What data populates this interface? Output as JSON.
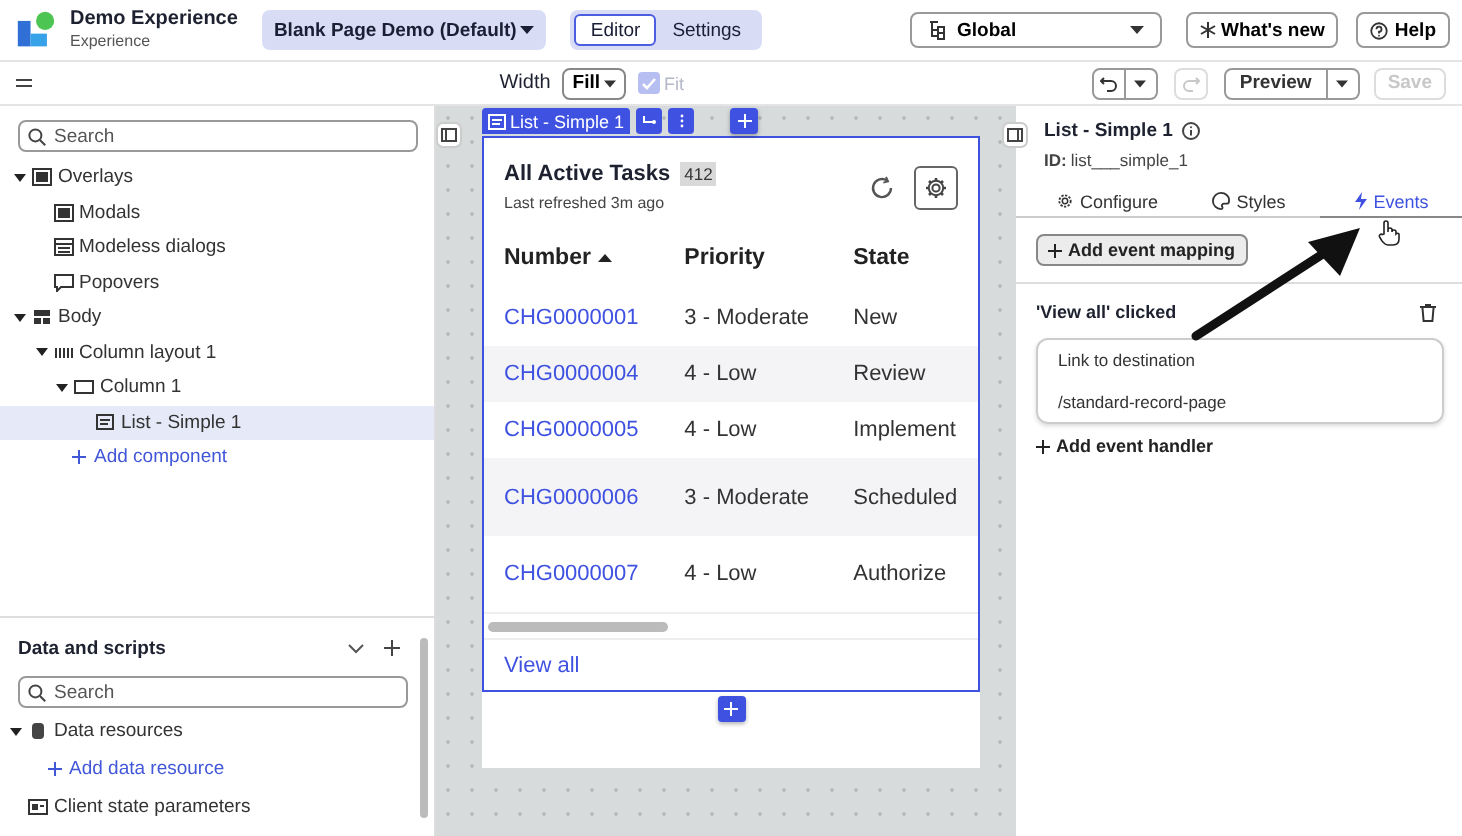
{
  "app": {
    "title": "Demo Experience",
    "subtitle": "Experience",
    "page_selector": "Blank Page Demo (Default)",
    "mode_tabs": [
      {
        "label": "Editor",
        "selected": true
      },
      {
        "label": "Settings",
        "selected": false
      }
    ],
    "scope_selector": "Global",
    "whats_new": "What's new",
    "help": "Help"
  },
  "toolbar": {
    "width_label": "Width",
    "width_value": "Fill",
    "fit": {
      "label": "Fit",
      "checked": true,
      "disabled": true
    },
    "undo_disabled": false,
    "redo_disabled": true,
    "preview": "Preview",
    "save": {
      "label": "Save",
      "disabled": true
    }
  },
  "outline": {
    "search_placeholder": "Search",
    "items": [
      {
        "label": "Overlays",
        "expanded": true,
        "selected": false,
        "children": [
          {
            "label": "Modals",
            "selected": false
          },
          {
            "label": "Modeless dialogs",
            "selected": false
          },
          {
            "label": "Popovers",
            "selected": false
          }
        ]
      },
      {
        "label": "Body",
        "expanded": true,
        "selected": false,
        "children": [
          {
            "label": "Column layout 1",
            "expanded": true,
            "selected": false,
            "children": [
              {
                "label": "Column 1",
                "expanded": true,
                "selected": false,
                "children": [
                  {
                    "label": "List - Simple 1",
                    "selected": true
                  }
                ]
              },
              {
                "label": "Add component",
                "kind": "add"
              }
            ]
          }
        ]
      }
    ]
  },
  "data_panel": {
    "title": "Data and scripts",
    "search_placeholder": "Search",
    "items": [
      {
        "label": "Data resources",
        "expanded": true,
        "selected": false,
        "children": [
          {
            "label": "Add data resource",
            "kind": "add"
          }
        ]
      },
      {
        "label": "Client state parameters",
        "selected": false
      }
    ]
  },
  "canvas": {
    "component_tag": "List - Simple 1",
    "list": {
      "title": "All Active Tasks",
      "count": "412",
      "subtitle": "Last refreshed 3m ago",
      "columns": [
        {
          "label": "Number",
          "sorted_ascending": true
        },
        {
          "label": "Priority"
        },
        {
          "label": "State"
        }
      ],
      "rows": [
        [
          "CHG0000001",
          "3 - Moderate",
          "New"
        ],
        [
          "CHG0000004",
          "4 - Low",
          "Review"
        ],
        [
          "CHG0000005",
          "4 - Low",
          "Implement"
        ],
        [
          "CHG0000006",
          "3 - Moderate",
          "Scheduled"
        ],
        [
          "CHG0000007",
          "4 - Low",
          "Authorize"
        ]
      ],
      "footer_link": "View all"
    }
  },
  "inspector": {
    "title": "List - Simple 1",
    "id_label": "ID:",
    "id_value": "list___simple_1",
    "tabs": [
      {
        "label": "Configure",
        "selected": false
      },
      {
        "label": "Styles",
        "selected": false
      },
      {
        "label": "Events",
        "selected": true
      }
    ],
    "add_mapping": "Add event mapping",
    "event_title": "'View all' clicked",
    "handler": {
      "action": "Link to destination",
      "target": "/standard-record-page"
    },
    "add_handler": "Add event handler"
  }
}
